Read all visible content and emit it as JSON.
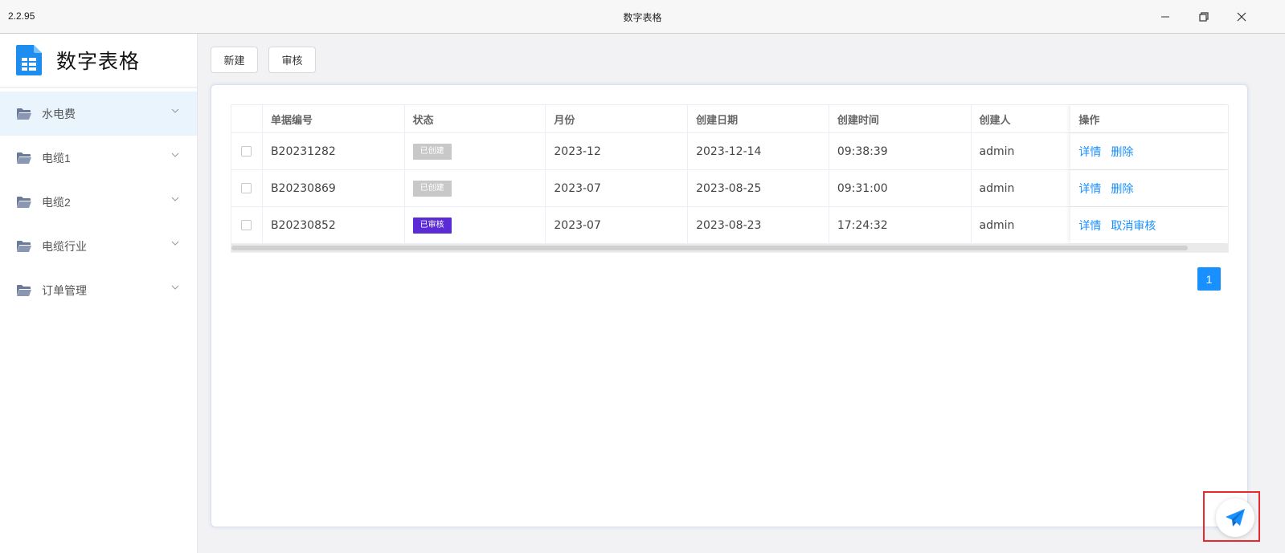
{
  "window": {
    "version": "2.2.95",
    "title": "数字表格",
    "minimize_icon": "minimize-icon",
    "restore_icon": "restore-icon",
    "close_icon": "close-icon"
  },
  "sidebar": {
    "brand_title": "数字表格",
    "brand_icon": "spreadsheet-logo-icon",
    "items": [
      {
        "label": "水电费",
        "icon": "folder-icon",
        "active": true
      },
      {
        "label": "电缆1",
        "icon": "folder-icon",
        "active": false
      },
      {
        "label": "电缆2",
        "icon": "folder-icon",
        "active": false
      },
      {
        "label": "电缆行业",
        "icon": "folder-icon",
        "active": false
      },
      {
        "label": "订单管理",
        "icon": "folder-icon",
        "active": false
      }
    ]
  },
  "toolbar": {
    "new_label": "新建",
    "review_label": "审核"
  },
  "table": {
    "columns": [
      "单据编号",
      "状态",
      "月份",
      "创建日期",
      "创建时间",
      "创建人",
      "操作"
    ],
    "rows": [
      {
        "id": "B20231282",
        "status": "已创建",
        "month": "2023-12",
        "date": "2023-12-14",
        "time": "09:38:39",
        "creator": "admin",
        "actions": [
          "详情",
          "删除"
        ]
      },
      {
        "id": "B20230869",
        "status": "已创建",
        "month": "2023-07",
        "date": "2023-08-25",
        "time": "09:31:00",
        "creator": "admin",
        "actions": [
          "详情",
          "删除"
        ]
      },
      {
        "id": "B20230852",
        "status": "已审核",
        "month": "2023-07",
        "date": "2023-08-23",
        "time": "17:24:32",
        "creator": "admin",
        "actions": [
          "详情",
          "取消审核"
        ]
      }
    ]
  },
  "pagination": {
    "current_page": "1"
  },
  "colors": {
    "accent": "#1890ff",
    "status_created": "#c8c8c8",
    "status_approved": "#5b2bd6",
    "active_nav_bg": "#e9f4fd",
    "highlight_box": "#e8292e"
  },
  "floating_button_icon": "send-paper-plane-icon"
}
